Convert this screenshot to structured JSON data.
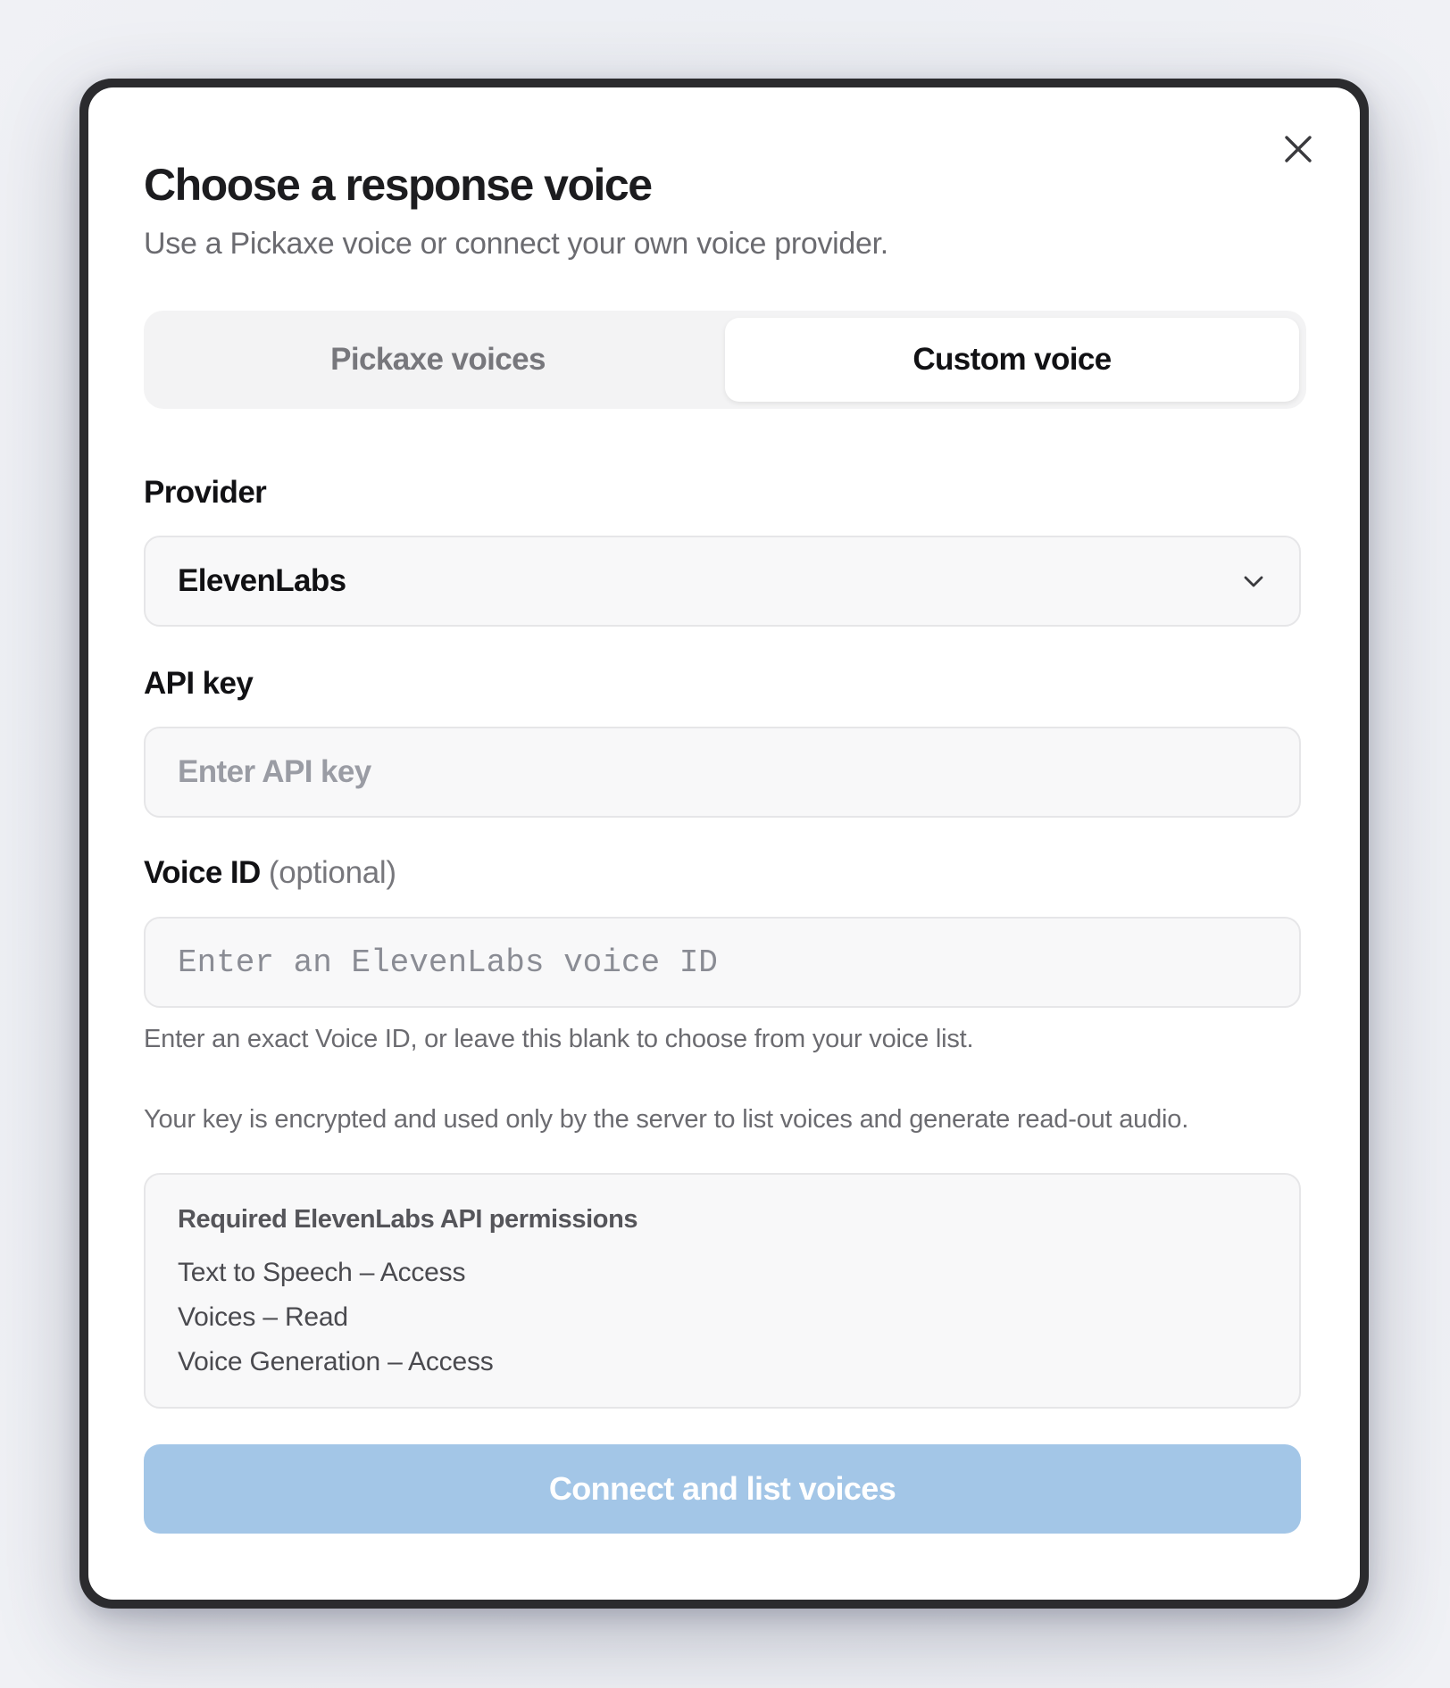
{
  "dialog": {
    "title": "Choose a response voice",
    "subtitle": "Use a Pickaxe voice or connect your own voice provider.",
    "close_icon": "close-icon"
  },
  "tabs": [
    {
      "label": "Pickaxe voices",
      "active": false
    },
    {
      "label": "Custom voice",
      "active": true
    }
  ],
  "provider": {
    "label": "Provider",
    "selected": "ElevenLabs",
    "icon": "chevron-down-icon"
  },
  "api_key": {
    "label": "API key",
    "value": "",
    "placeholder": "Enter API key"
  },
  "voice_id": {
    "label": "Voice ID",
    "optional_label": "(optional)",
    "value": "",
    "placeholder": "Enter an ElevenLabs voice ID",
    "helper": "Enter an exact Voice ID, or leave this blank to choose from your voice list."
  },
  "encryption_note": "Your key is encrypted and used only by the server to list voices and generate read-out audio.",
  "permissions": {
    "title": "Required ElevenLabs API permissions",
    "items": [
      "Text to Speech – Access",
      "Voices – Read",
      "Voice Generation – Access"
    ]
  },
  "primary_button": {
    "label": "Connect and list voices",
    "disabled": true
  },
  "colors": {
    "accent_disabled": "#a3c6e7",
    "frame": "#2b2b2e",
    "background": "#eceef3"
  }
}
